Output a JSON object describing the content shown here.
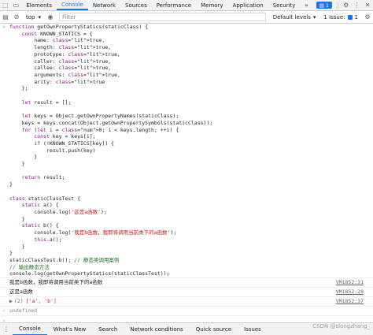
{
  "devtools": {
    "tabs": [
      "Elements",
      "Console",
      "Network",
      "Sources",
      "Performance",
      "Memory",
      "Application",
      "Security"
    ],
    "active_tab": "Console",
    "tab_overflow": "»",
    "messages_badge": "1",
    "colors": {
      "accent": "#1a73e8",
      "keyword": "#881280",
      "string": "#c41a16",
      "comment": "#236e25",
      "number": "#1c00cf"
    }
  },
  "toolbar": {
    "context": "top",
    "filter_placeholder": "Filter",
    "levels": "Default levels",
    "issues": "1 Issue:",
    "issues_count": "1"
  },
  "console": {
    "code_lines": [
      "function getOwnPropertyStatics(staticClass) {",
      "    const KNOWN_STATICS = {",
      "        name: true,",
      "        length: true,",
      "        prototype: true,",
      "        caller: true,",
      "        callee: true,",
      "        arguments: true,",
      "        arity: true",
      "    };",
      "",
      "    let result = [];",
      "",
      "    let keys = Object.getOwnPropertyNames(staticClass);",
      "    keys = keys.concat(Object.getOwnPropertySymbols(staticClass));",
      "    for (let i = 0; i < keys.length; ++i) {",
      "        const key = keys[i];",
      "        if (!KNOWN_STATICS[key]) {",
      "            result.push(key)",
      "        }",
      "    }",
      "",
      "    return result;",
      "}",
      "",
      "class staticClassTest {",
      "    static a() {",
      "        console.log('这是a函数');",
      "    }",
      "    static b() {",
      "        console.log('我是b函数，我即将调用当前类下的a函数');",
      "        this.a();",
      "    }",
      "}",
      "staticClassTest.b(); // 静态类调用案例",
      "// 输出静态方法",
      "console.log(getOwnPropertyStatics(staticClassTest));"
    ],
    "logs": [
      {
        "text": "我是b函数，我即将调用当前类下的a函数",
        "source": "VM1852:31"
      },
      {
        "text": "这是a函数",
        "source": "VM1852:28"
      }
    ],
    "array_log": {
      "length": "(2)",
      "items": "['a', 'b']",
      "source": "VM1852:37"
    },
    "return_value": "undefined"
  },
  "drawer": {
    "tabs": [
      "Console",
      "What's New",
      "Search",
      "Network conditions",
      "Quick source",
      "Issues"
    ],
    "watermark": "CSDN @slongzhang_"
  }
}
